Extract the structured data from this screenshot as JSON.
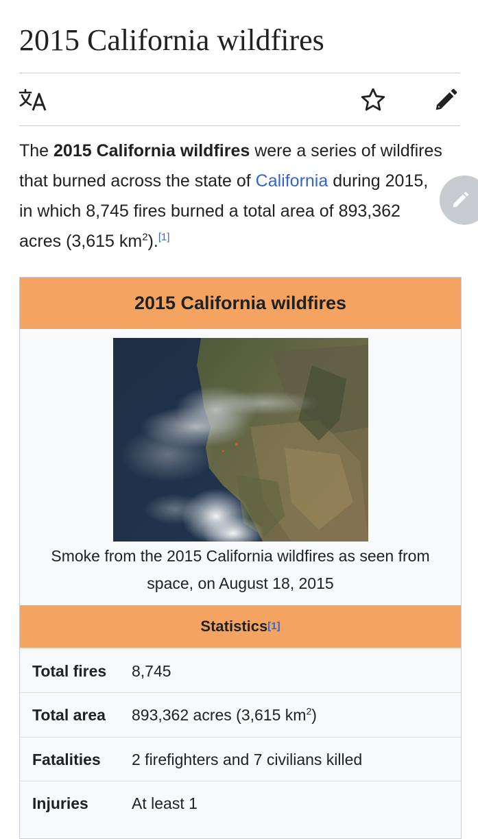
{
  "page": {
    "title": "2015 California wildfires"
  },
  "toolbar": {
    "language_icon": "translate-icon",
    "watch_icon": "star-icon",
    "edit_icon": "pencil-icon"
  },
  "lead": {
    "part1": "The ",
    "bold": "2015 California wildfires",
    "part2": " were a series of wildfires that burned across the state of ",
    "link_california": "California",
    "part3": " during 2015, in which 8,745 fires burned a total area of 893,362 acres (3,615 km",
    "sup2": "2",
    "part4": ").",
    "ref": "[1]"
  },
  "infobox": {
    "title": "2015 California wildfires",
    "caption": "Smoke from the 2015 California wildfires as seen from space, on August 18, 2015",
    "stats_header": "Statistics",
    "stats_ref": "[1]",
    "rows": [
      {
        "label": "Total fires",
        "value": "8,745"
      },
      {
        "label": "Total area",
        "value_pre": "893,362 acres (3,615 km",
        "value_sup": "2",
        "value_post": ")"
      },
      {
        "label": "Fatalities",
        "value": "2 firefighters and 7 civilians killed"
      },
      {
        "label": "Injuries",
        "value": "At least 1"
      }
    ]
  },
  "colors": {
    "accent": "#f4a460",
    "link": "#3366cc",
    "text": "#202122"
  }
}
